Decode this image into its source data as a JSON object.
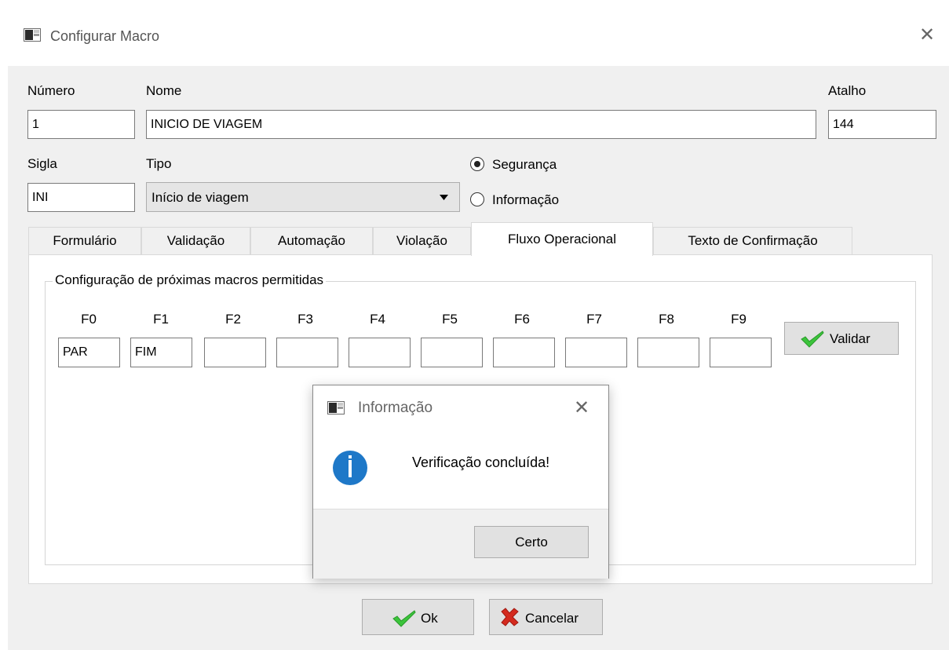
{
  "window": {
    "title": "Configurar Macro",
    "close_glyph": "✕"
  },
  "form": {
    "numero_label": "Número",
    "numero_value": "1",
    "nome_label": "Nome",
    "nome_value": "INICIO DE VIAGEM",
    "atalho_label": "Atalho",
    "atalho_value": "144",
    "sigla_label": "Sigla",
    "sigla_value": "INI",
    "tipo_label": "Tipo",
    "tipo_value": "Início de viagem",
    "radios": [
      {
        "label": "Segurança",
        "checked": true
      },
      {
        "label": "Informação",
        "checked": false
      }
    ]
  },
  "tabs": [
    {
      "label": "Formulário",
      "active": false
    },
    {
      "label": "Validação",
      "active": false
    },
    {
      "label": "Automação",
      "active": false
    },
    {
      "label": "Violação",
      "active": false
    },
    {
      "label": "Fluxo Operacional",
      "active": true
    },
    {
      "label": "Texto de Confirmação",
      "active": false
    }
  ],
  "fluxo": {
    "group_title": "Configuração de próximas macros permitidas",
    "keys": [
      {
        "label": "F0",
        "value": "PAR"
      },
      {
        "label": "F1",
        "value": "FIM"
      },
      {
        "label": "F2",
        "value": ""
      },
      {
        "label": "F3",
        "value": ""
      },
      {
        "label": "F4",
        "value": ""
      },
      {
        "label": "F5",
        "value": ""
      },
      {
        "label": "F6",
        "value": ""
      },
      {
        "label": "F7",
        "value": ""
      },
      {
        "label": "F8",
        "value": ""
      },
      {
        "label": "F9",
        "value": ""
      }
    ],
    "validar_label": "Validar"
  },
  "buttons": {
    "ok_label": "Ok",
    "cancel_label": "Cancelar"
  },
  "dialog": {
    "title": "Informação",
    "message": "Verificação concluída!",
    "ok_label": "Certo",
    "close_glyph": "✕"
  },
  "icons": {
    "app": "app-window-icon",
    "check": "green-check-icon",
    "cancel": "red-x-icon",
    "info": "info-icon"
  },
  "colors": {
    "check_green": "#3cc43c",
    "cancel_red": "#d42a1e",
    "info_blue": "#1e78c8"
  }
}
